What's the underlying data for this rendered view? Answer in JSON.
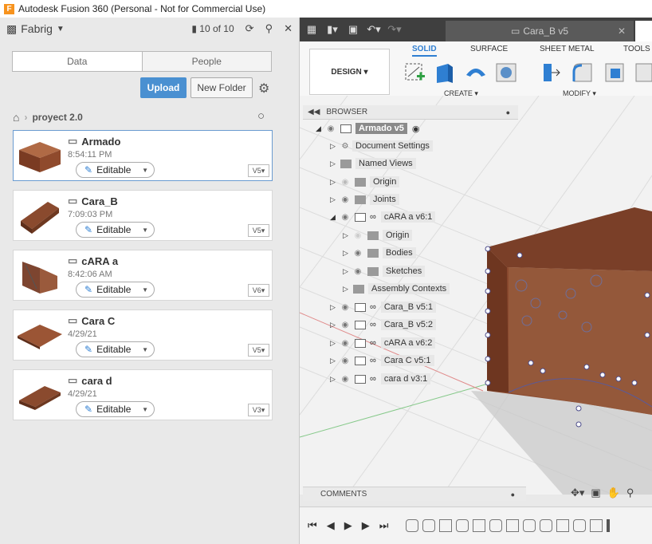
{
  "window": {
    "title": "Autodesk Fusion 360 (Personal - Not for Commercial Use)",
    "logo": "F"
  },
  "left_panel": {
    "team_name": "Fabrig",
    "count_label": "10 of 10",
    "tabs": [
      "Data",
      "People"
    ],
    "upload_label": "Upload",
    "new_folder_label": "New Folder",
    "breadcrumb": "proyect 2.0",
    "items": [
      {
        "name": "Armado",
        "time": "8:54:11 PM",
        "status": "Editable",
        "version": "V5"
      },
      {
        "name": "Cara_B",
        "time": "7:09:03 PM",
        "status": "Editable",
        "version": "V5"
      },
      {
        "name": "cARA a",
        "time": "8:42:06 AM",
        "status": "Editable",
        "version": "V6"
      },
      {
        "name": "Cara C",
        "time": "4/29/21",
        "status": "Editable",
        "version": "V5"
      },
      {
        "name": "cara d",
        "time": "4/29/21",
        "status": "Editable",
        "version": "V3"
      }
    ]
  },
  "doc_tab": {
    "title": "Cara_B v5"
  },
  "ribbon": {
    "workspace": "DESIGN",
    "tabs": [
      "SOLID",
      "SURFACE",
      "SHEET METAL",
      "TOOLS"
    ],
    "groups": [
      "CREATE",
      "MODIFY"
    ]
  },
  "browser": {
    "title": "BROWSER",
    "root": "Armado v5",
    "nodes": [
      "Document Settings",
      "Named Views",
      "Origin",
      "Joints",
      "cARA a v6:1",
      "Origin",
      "Bodies",
      "Sketches",
      "Assembly Contexts",
      "Cara_B v5:1",
      "Cara_B v5:2",
      "cARA a v6:2",
      "Cara C v5:1",
      "cara d v3:1"
    ]
  },
  "comments": {
    "title": "COMMENTS"
  },
  "colors": {
    "accent": "#2f7fd2",
    "upload": "#4a90d1",
    "toolbar": "#3f3f3f",
    "wood": "#8a4a2e"
  }
}
